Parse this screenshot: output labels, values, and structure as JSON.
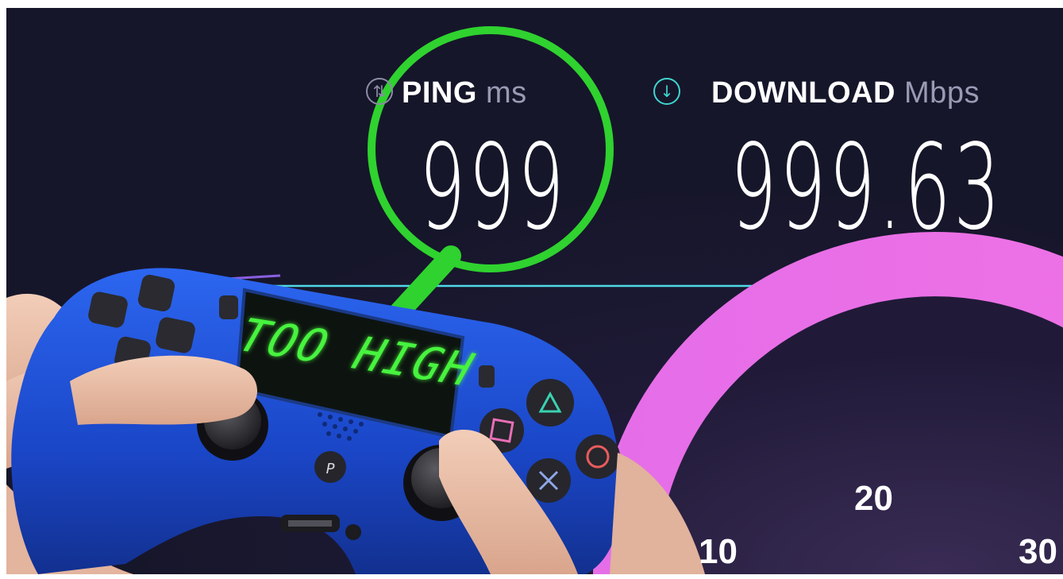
{
  "ping": {
    "label": "PING",
    "unit": "ms",
    "value": "999",
    "icon": "ping-icon"
  },
  "download": {
    "label": "DOWNLOAD",
    "unit": "Mbps",
    "value": "999.63",
    "icon": "download-arrow-icon"
  },
  "gauge": {
    "labels": [
      "10",
      "20",
      "30"
    ]
  },
  "controller": {
    "display_text": "TOO HIGH"
  },
  "colors": {
    "background": "#16162a",
    "highlight": "#2fd22f",
    "download_accent": "#40d5cf",
    "gauge_arc": "#e56ee8",
    "controller_blue": "#1d4fd8",
    "lcd_text": "#47f33f"
  }
}
